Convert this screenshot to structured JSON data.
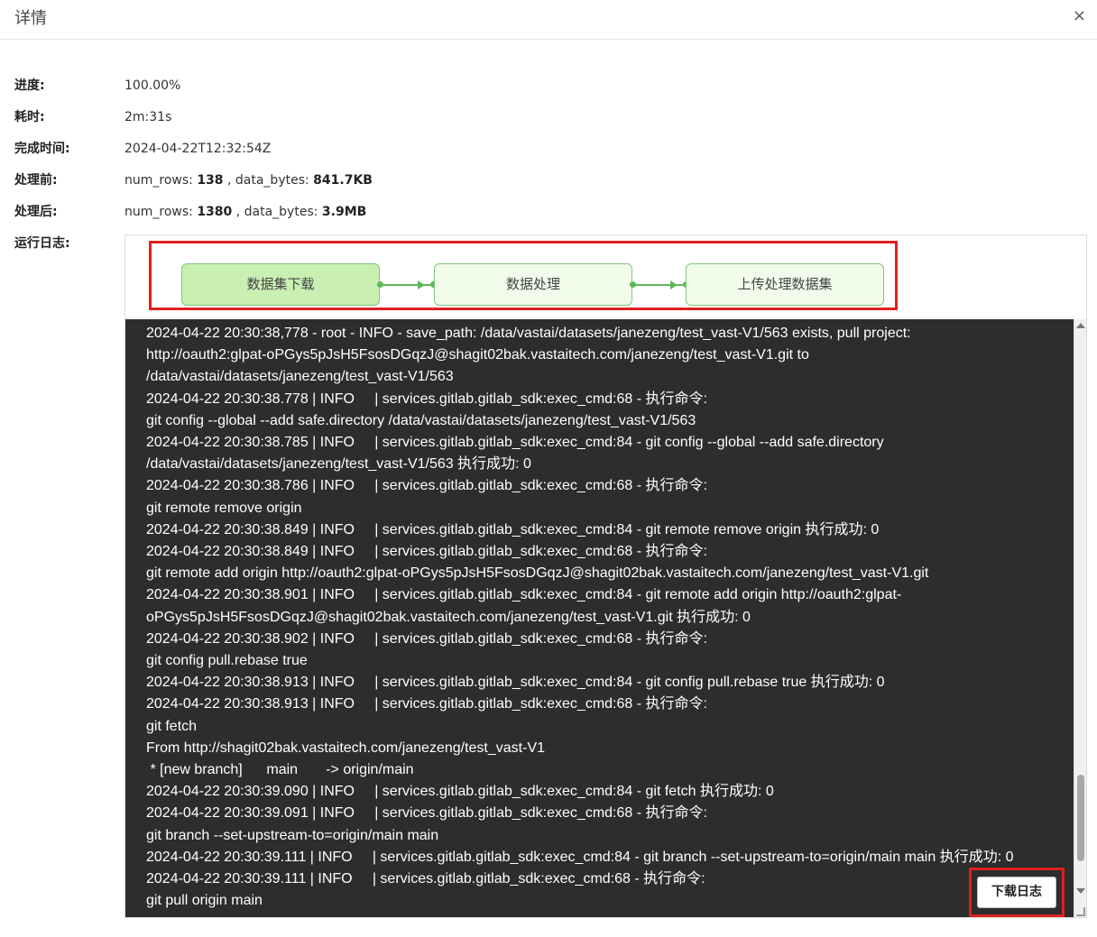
{
  "modal": {
    "title": "详情",
    "close_label": "×"
  },
  "info": {
    "progress_label": "进度:",
    "progress_value": "100.00%",
    "elapsed_label": "耗时:",
    "elapsed_value": "2m:31s",
    "finish_label": "完成时间:",
    "finish_value": "2024-04-22T12:32:54Z",
    "before_label": "处理前:",
    "before": {
      "rows_key": "num_rows: ",
      "rows": "138",
      "sep": " , data_bytes: ",
      "bytes": "841.7KB"
    },
    "after_label": "处理后:",
    "after": {
      "rows_key": "num_rows: ",
      "rows": "1380",
      "sep": " , data_bytes: ",
      "bytes": "3.9MB"
    },
    "log_label": "运行日志:"
  },
  "flow": {
    "steps": [
      {
        "label": "数据集下载",
        "status": "active"
      },
      {
        "label": "数据处理",
        "status": "pending"
      },
      {
        "label": "上传处理数据集",
        "status": "pending"
      }
    ]
  },
  "log": {
    "lines": [
      "2024-04-22 20:30:38,778 - root - INFO - save_path: /data/vastai/datasets/janezeng/test_vast-V1/563 exists, pull project:",
      "http://oauth2:glpat-oPGys5pJsH5FsosDGqzJ@shagit02bak.vastaitech.com/janezeng/test_vast-V1.git to",
      "/data/vastai/datasets/janezeng/test_vast-V1/563",
      "2024-04-22 20:30:38.778 | INFO     | services.gitlab.gitlab_sdk:exec_cmd:68 - 执行命令:",
      "git config --global --add safe.directory /data/vastai/datasets/janezeng/test_vast-V1/563",
      "2024-04-22 20:30:38.785 | INFO     | services.gitlab.gitlab_sdk:exec_cmd:84 - git config --global --add safe.directory",
      "/data/vastai/datasets/janezeng/test_vast-V1/563 执行成功: 0",
      "2024-04-22 20:30:38.786 | INFO     | services.gitlab.gitlab_sdk:exec_cmd:68 - 执行命令:",
      "git remote remove origin",
      "2024-04-22 20:30:38.849 | INFO     | services.gitlab.gitlab_sdk:exec_cmd:84 - git remote remove origin 执行成功: 0",
      "2024-04-22 20:30:38.849 | INFO     | services.gitlab.gitlab_sdk:exec_cmd:68 - 执行命令:",
      "git remote add origin http://oauth2:glpat-oPGys5pJsH5FsosDGqzJ@shagit02bak.vastaitech.com/janezeng/test_vast-V1.git",
      "2024-04-22 20:30:38.901 | INFO     | services.gitlab.gitlab_sdk:exec_cmd:84 - git remote add origin http://oauth2:glpat-",
      "oPGys5pJsH5FsosDGqzJ@shagit02bak.vastaitech.com/janezeng/test_vast-V1.git 执行成功: 0",
      "2024-04-22 20:30:38.902 | INFO     | services.gitlab.gitlab_sdk:exec_cmd:68 - 执行命令:",
      "git config pull.rebase true",
      "2024-04-22 20:30:38.913 | INFO     | services.gitlab.gitlab_sdk:exec_cmd:84 - git config pull.rebase true 执行成功: 0",
      "2024-04-22 20:30:38.913 | INFO     | services.gitlab.gitlab_sdk:exec_cmd:68 - 执行命令:",
      "git fetch",
      "From http://shagit02bak.vastaitech.com/janezeng/test_vast-V1",
      " * [new branch]      main       -> origin/main",
      "2024-04-22 20:30:39.090 | INFO     | services.gitlab.gitlab_sdk:exec_cmd:84 - git fetch 执行成功: 0",
      "2024-04-22 20:30:39.091 | INFO     | services.gitlab.gitlab_sdk:exec_cmd:68 - 执行命令:",
      "git branch --set-upstream-to=origin/main main",
      "2024-04-22 20:30:39.111 | INFO     | services.gitlab.gitlab_sdk:exec_cmd:84 - git branch --set-upstream-to=origin/main main 执行成功: 0",
      "2024-04-22 20:30:39.111 | INFO     | services.gitlab.gitlab_sdk:exec_cmd:68 - 执行命令:",
      "git pull origin main"
    ],
    "download_label": "下载日志"
  },
  "colors": {
    "highlight": "#e02020",
    "flow_border": "#7ec87e",
    "console_bg": "#2d2d2d"
  }
}
